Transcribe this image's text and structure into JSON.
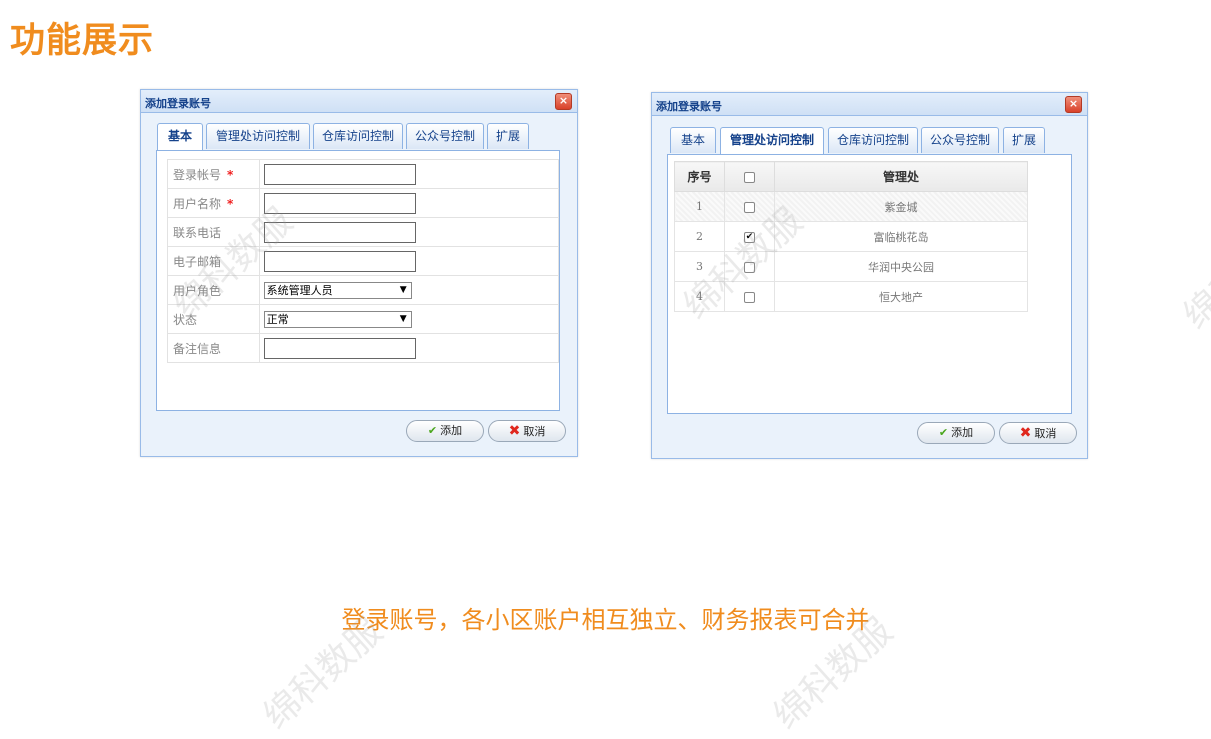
{
  "page": {
    "title": "功能展示",
    "caption": "登录账号，各小区账户相互独立、财务报表可合并",
    "watermark": "绵科数服"
  },
  "dialog_left": {
    "title": "添加登录账号",
    "tabs": [
      "基本",
      "管理处访问控制",
      "仓库访问控制",
      "公众号控制",
      "扩展"
    ],
    "active_tab": "基本",
    "fields": [
      {
        "label": "登录帐号",
        "required": true,
        "type": "text",
        "value": ""
      },
      {
        "label": "用户名称",
        "required": true,
        "type": "text",
        "value": ""
      },
      {
        "label": "联系电话",
        "required": false,
        "type": "text",
        "value": ""
      },
      {
        "label": "电子邮箱",
        "required": false,
        "type": "text",
        "value": ""
      },
      {
        "label": "用户角色",
        "required": false,
        "type": "select",
        "value": "系统管理人员"
      },
      {
        "label": "状态",
        "required": false,
        "type": "select",
        "value": "正常"
      },
      {
        "label": "备注信息",
        "required": false,
        "type": "text",
        "value": ""
      }
    ],
    "required_mark": "*",
    "buttons": {
      "add": "添加",
      "cancel": "取消"
    }
  },
  "dialog_right": {
    "title": "添加登录账号",
    "tabs": [
      "基本",
      "管理处访问控制",
      "仓库访问控制",
      "公众号控制",
      "扩展"
    ],
    "active_tab": "管理处访问控制",
    "table": {
      "headers": {
        "index": "序号",
        "name": "管理处"
      },
      "rows": [
        {
          "index": "1",
          "name": "紫金城",
          "checked": false
        },
        {
          "index": "2",
          "name": "富临桃花岛",
          "checked": true
        },
        {
          "index": "3",
          "name": "华润中央公园",
          "checked": false
        },
        {
          "index": "4",
          "name": "恒大地产",
          "checked": false
        }
      ]
    },
    "buttons": {
      "add": "添加",
      "cancel": "取消"
    }
  },
  "icons": {
    "close": "close-icon",
    "ok": "check-icon",
    "cancel": "cross-icon",
    "dropdown": "triangle-down-icon"
  },
  "colors": {
    "accent": "#f08c1e",
    "dialog_title": "#15428b",
    "border": "#99bbe8"
  }
}
